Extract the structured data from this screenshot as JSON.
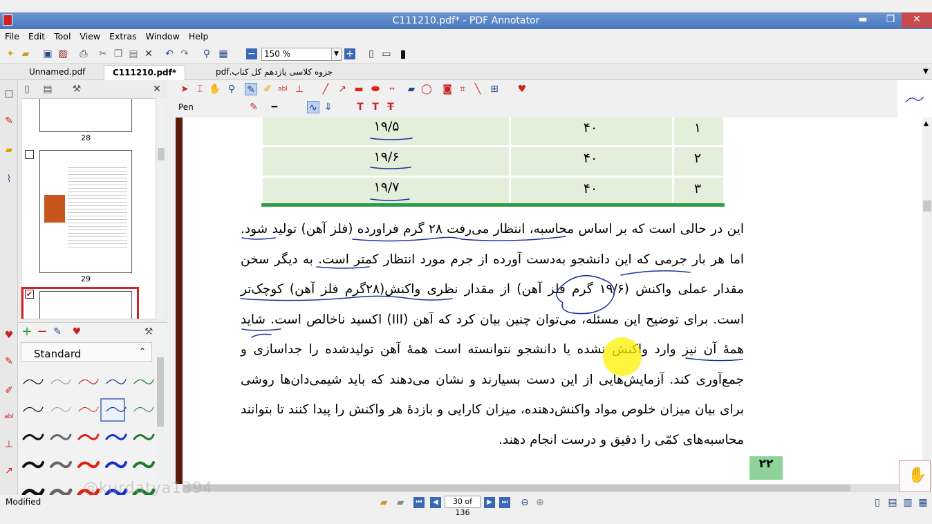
{
  "window": {
    "title": "C111210.pdf* - PDF Annotator",
    "minimize": "▬",
    "restore": "❐",
    "close": "✕"
  },
  "menu": [
    "File",
    "Edit",
    "Tool",
    "View",
    "Extras",
    "Window",
    "Help"
  ],
  "zoom": {
    "value": "150 %"
  },
  "tabs": [
    {
      "label": "Unnamed.pdf"
    },
    {
      "label": "C111210.pdf*"
    },
    {
      "label": "جزوه کلاسی یازدهم کل کتاب.pdf"
    }
  ],
  "thumbnails": [
    {
      "label": "28"
    },
    {
      "label": "29"
    }
  ],
  "pen_panel": {
    "set_name": "Standard"
  },
  "tool_label": "Pen",
  "table": {
    "rows": [
      {
        "col1": "۱۹/۵",
        "col2": "۴۰",
        "col3": "۱"
      },
      {
        "col1": "۱۹/۶",
        "col2": "۴۰",
        "col3": "۲"
      },
      {
        "col1": "۱۹/۷",
        "col2": "۴۰",
        "col3": "۳"
      }
    ]
  },
  "paragraph": "این در حالی است که بر اساس محاسبه، انتظار می‌رفت ۲۸ گرم فراورده (فلز آهن) تولید شود. اما هر بار جرمی که این دانشجو به‌دست آورده از جرم مورد انتظار کمتر است. به دیگر سخن مقدار عملی واکنش (۱۹/۶ گرم فلز آهن) از مقدار نظری واکنش(۲۸گرم فلز آهن) کوچک‌تر است. برای توضیح این مسئله، می‌توان چنین بیان کرد که آهن (III) اکسید ناخالص است. شاید همهٔ آن نیز وارد واکنش نشده یا دانشجو نتوانسته است همهٔ آهن تولیدشده را جداسازی و جمع‌آوری کند. آزمایش‌هایی از این دست بسیارند و نشان می‌دهند که باید شیمی‌دان‌ها روشی برای بیان میزان خلوص مواد واکنش‌دهنده، میزان کارایی و بازدهٔ هر واکنش را پیدا کنند تا بتوانند محاسبه‌های کمّی را دقیق و درست انجام دهند.",
  "page_number_badge": "۲۲",
  "status": {
    "left": "Modified",
    "page": "30 of 136",
    "watermark": "@kurdatya1394"
  },
  "colors": {
    "titlebar": "#4a78bd",
    "table_bg": "#e2efda",
    "table_rule": "#2e9c4a",
    "ink_blue": "#1e2f9e",
    "highlight": "#fff000"
  }
}
